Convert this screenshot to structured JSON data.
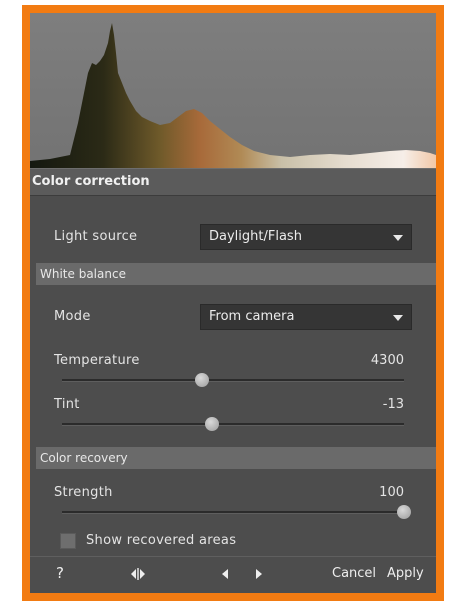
{
  "color_correction": {
    "title": "Color correction",
    "light_source": {
      "label": "Light source",
      "value": "Daylight/Flash"
    }
  },
  "white_balance": {
    "title": "White balance",
    "mode": {
      "label": "Mode",
      "value": "From camera"
    },
    "temperature": {
      "label": "Temperature",
      "value": "4300",
      "level": 0.41
    },
    "tint": {
      "label": "Tint",
      "value": "-13",
      "level": 0.44
    }
  },
  "color_recovery": {
    "title": "Color recovery",
    "strength": {
      "label": "Strength",
      "value": "100",
      "level": 1.0
    },
    "show_recovered": {
      "label": "Show recovered areas",
      "checked": false
    }
  },
  "footer": {
    "help": "?",
    "cancel": "Cancel",
    "apply": "Apply"
  },
  "colors": {
    "frame_border": "#f27b12",
    "panel_bg": "#4d4d4d",
    "dropdown_bg": "#353535"
  }
}
